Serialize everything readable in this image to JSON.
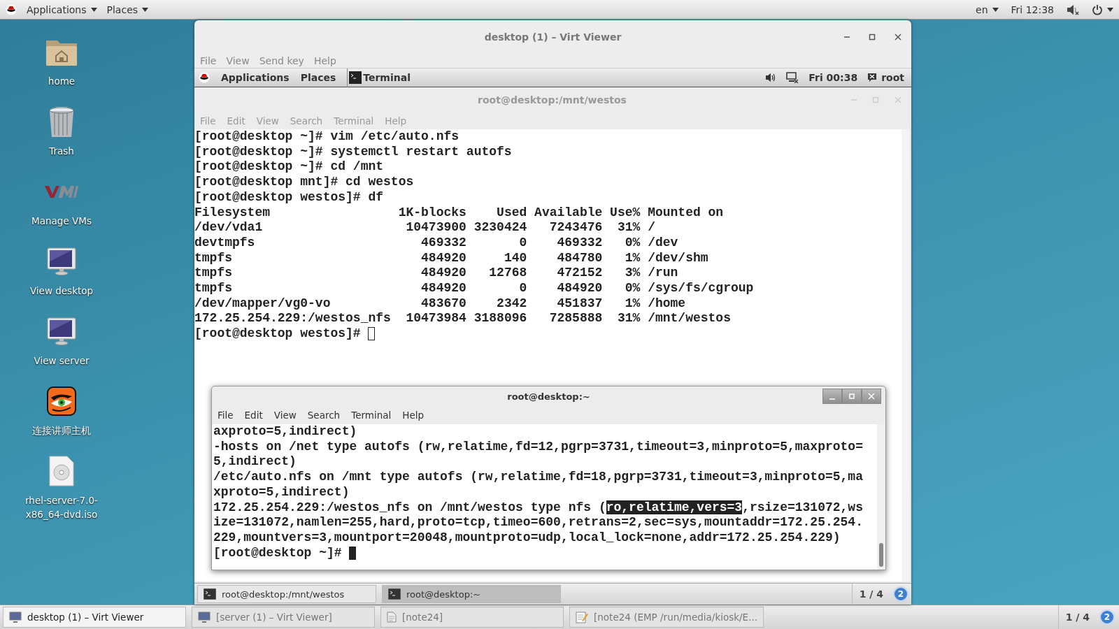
{
  "top_bar": {
    "menus": [
      "Applications",
      "Places"
    ],
    "language": "en",
    "clock": "Fri 12:38"
  },
  "desktop_icons": [
    {
      "kind": "folder",
      "label": "home"
    },
    {
      "kind": "trash",
      "label": "Trash"
    },
    {
      "kind": "vm",
      "label": "Manage VMs"
    },
    {
      "kind": "monitor",
      "label": "View desktop"
    },
    {
      "kind": "monitor",
      "label": "View server"
    },
    {
      "kind": "tiger",
      "label": "连接讲师主机"
    },
    {
      "kind": "disc",
      "label": "rhel-server-7.0-x86_64-dvd.iso"
    }
  ],
  "viewer": {
    "title": "desktop (1) – Virt Viewer",
    "menus": [
      "File",
      "View",
      "Send key",
      "Help"
    ],
    "guest_bar": {
      "menus": [
        "Applications",
        "Places"
      ],
      "active_app": "Terminal",
      "clock": "Fri 00:38",
      "user": "root"
    },
    "terminal": {
      "title": "root@desktop:/mnt/westos",
      "menus": [
        "File",
        "Edit",
        "View",
        "Search",
        "Terminal",
        "Help"
      ],
      "lines": [
        "[root@desktop ~]# vim /etc/auto.nfs",
        "[root@desktop ~]# systemctl restart autofs",
        "[root@desktop ~]# cd /mnt",
        "[root@desktop mnt]# cd westos",
        "[root@desktop westos]# df"
      ],
      "df": {
        "columns": [
          "Filesystem",
          "1K-blocks",
          "Used",
          "Available",
          "Use%",
          "Mounted on"
        ],
        "rows": [
          [
            "/dev/vda1",
            "10473900",
            "3230424",
            "7243476",
            "31%",
            "/"
          ],
          [
            "devtmpfs",
            "469332",
            "0",
            "469332",
            "0%",
            "/dev"
          ],
          [
            "tmpfs",
            "484920",
            "140",
            "484780",
            "1%",
            "/dev/shm"
          ],
          [
            "tmpfs",
            "484920",
            "12768",
            "472152",
            "3%",
            "/run"
          ],
          [
            "tmpfs",
            "484920",
            "0",
            "484920",
            "0%",
            "/sys/fs/cgroup"
          ],
          [
            "/dev/mapper/vg0-vo",
            "483670",
            "2342",
            "451837",
            "1%",
            "/home"
          ],
          [
            "172.25.254.229:/westos_nfs",
            "10473984",
            "3188096",
            "7285888",
            "31%",
            "/mnt/westos"
          ]
        ]
      },
      "prompt": "[root@desktop westos]#"
    },
    "front_terminal": {
      "title": "root@desktop:~",
      "menus": [
        "File",
        "Edit",
        "View",
        "Search",
        "Terminal",
        "Help"
      ],
      "lines": [
        [
          {
            "text": "axproto=5,indirect)",
            "highlighted": false
          }
        ],
        [
          {
            "text": "-hosts on /net type autofs (rw,relatime,fd=12,pgrp=3731,timeout=3,minproto=5,maxproto=",
            "highlighted": false
          }
        ],
        [
          {
            "text": "5,indirect)",
            "highlighted": false
          }
        ],
        [
          {
            "text": "/etc/auto.nfs on /mnt type autofs (rw,relatime,fd=18,pgrp=3731,timeout=3,minproto=5,ma",
            "highlighted": false
          }
        ],
        [
          {
            "text": "xproto=5,indirect)",
            "highlighted": false
          }
        ],
        [
          {
            "text": "172.25.254.229:/westos_nfs on /mnt/westos type nfs (",
            "highlighted": false
          },
          {
            "text": "ro,relatime,vers=3",
            "highlighted": true
          },
          {
            "text": ",rsize=131072,ws",
            "highlighted": false
          }
        ],
        [
          {
            "text": "ize=131072,namlen=255,hard,proto=tcp,timeo=600,retrans=2,sec=sys,mountaddr=172.25.254.",
            "highlighted": false
          }
        ],
        [
          {
            "text": "229,mountvers=3,mountport=20048,mountproto=udp,local_lock=none,addr=172.25.254.229)",
            "highlighted": false
          }
        ]
      ],
      "prompt": "[root@desktop ~]#"
    },
    "guest_taskbar": {
      "items": [
        {
          "label": "root@desktop:/mnt/westos",
          "selected": false
        },
        {
          "label": "root@desktop:~",
          "selected": true
        }
      ],
      "workspace": "1 / 4",
      "workspace_badge": "2"
    }
  },
  "taskbar": {
    "items": [
      {
        "kind": "viewer",
        "label": "desktop (1) – Virt Viewer",
        "selected": true
      },
      {
        "kind": "viewer",
        "label": "[server (1) – Virt Viewer]",
        "selected": false
      },
      {
        "kind": "file",
        "label": "[note24]",
        "selected": false
      },
      {
        "kind": "editor",
        "label": "[note24 (EMP /run/media/kiosk/E...",
        "selected": false
      }
    ],
    "workspace": "1 / 4",
    "workspace_badge": "2"
  }
}
